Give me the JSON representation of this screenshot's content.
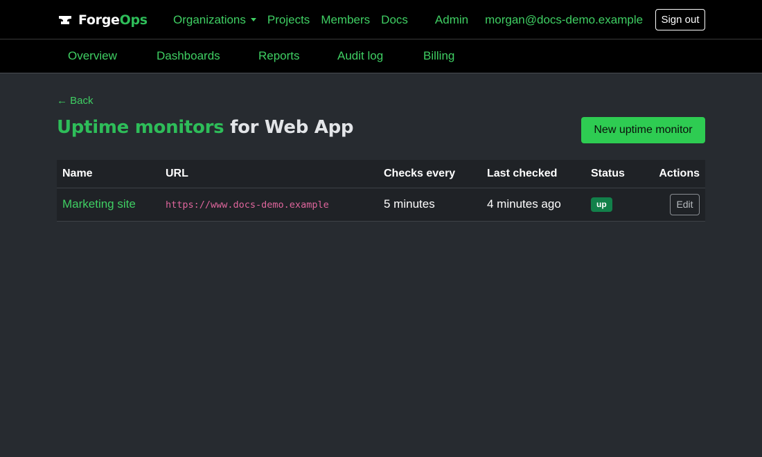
{
  "colors": {
    "accent": "#3fcf63",
    "brand_green": "#2ebd59",
    "primary_button": "#2ecc52",
    "status_up": "#12804a",
    "url_code": "#e0669d",
    "background": "#272b30",
    "navbar": "#000000"
  },
  "brand": {
    "icon": "anvil-icon",
    "part1": "Forge",
    "part2": "Ops"
  },
  "topnav": {
    "organizations": "Organizations",
    "projects": "Projects",
    "members": "Members",
    "docs": "Docs",
    "admin": "Admin",
    "user": "morgan@docs-demo.example",
    "sign_out": "Sign out"
  },
  "subnav": {
    "items": [
      "Overview",
      "Dashboards",
      "Reports",
      "Audit log",
      "Billing"
    ]
  },
  "page": {
    "back": "← Back",
    "title_highlight": "Uptime monitors",
    "title_rest": " for Web App",
    "new_button": "New uptime monitor"
  },
  "table": {
    "headers": [
      "Name",
      "URL",
      "Checks every",
      "Last checked",
      "Status",
      "Actions"
    ],
    "rows": [
      {
        "name": "Marketing site",
        "url": "https://www.docs-demo.example",
        "interval": "5 minutes",
        "last_checked": "4 minutes ago",
        "status": "up",
        "action": "Edit"
      }
    ]
  }
}
